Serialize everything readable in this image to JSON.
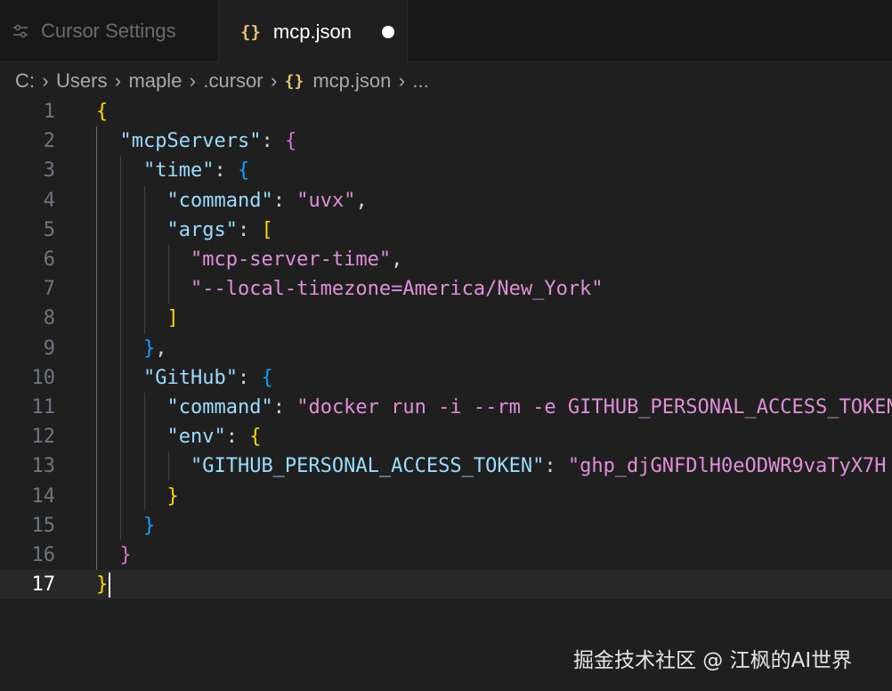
{
  "tabs": [
    {
      "label": "Cursor Settings",
      "icon": "settings-sliders-icon",
      "active": false
    },
    {
      "label": "mcp.json",
      "icon": "json-braces-icon",
      "active": true,
      "unsaved": true
    }
  ],
  "breadcrumb": [
    "C:",
    "Users",
    "maple",
    ".cursor",
    "mcp.json",
    "..."
  ],
  "editor": {
    "current_line": 17,
    "line_numbers": [
      "1",
      "2",
      "3",
      "4",
      "5",
      "6",
      "7",
      "8",
      "9",
      "10",
      "11",
      "12",
      "13",
      "14",
      "15",
      "16",
      "17"
    ],
    "tokens": {
      "open_brace": "{",
      "close_brace": "}",
      "mcpServers_key": "\"mcpServers\"",
      "time_key": "\"time\"",
      "command_key": "\"command\"",
      "uvx_value": "\"uvx\"",
      "args_key": "\"args\"",
      "open_bracket": "[",
      "close_bracket": "]",
      "arg1": "\"mcp-server-time\"",
      "arg2": "\"--local-timezone=America/New_York\"",
      "github_key": "\"GitHub\"",
      "docker_value": "\"docker run -i --rm -e GITHUB_PERSONAL_ACCESS_TOKEN",
      "env_key": "\"env\"",
      "token_key": "\"GITHUB_PERSONAL_ACCESS_TOKEN\"",
      "token_value": "\"ghp_djGNFDlH0eODWR9vaTyX7H",
      "colon": ": ",
      "comma": ","
    }
  },
  "watermark": "掘金技术社区 @ 江枫的AI世界",
  "colors": {
    "background": "#1f1f1f",
    "string": "#ce9178",
    "key": "#9cdcfe",
    "bracket_gold": "#ffd700",
    "bracket_purple": "#da70d6",
    "bracket_blue": "#179fff"
  }
}
